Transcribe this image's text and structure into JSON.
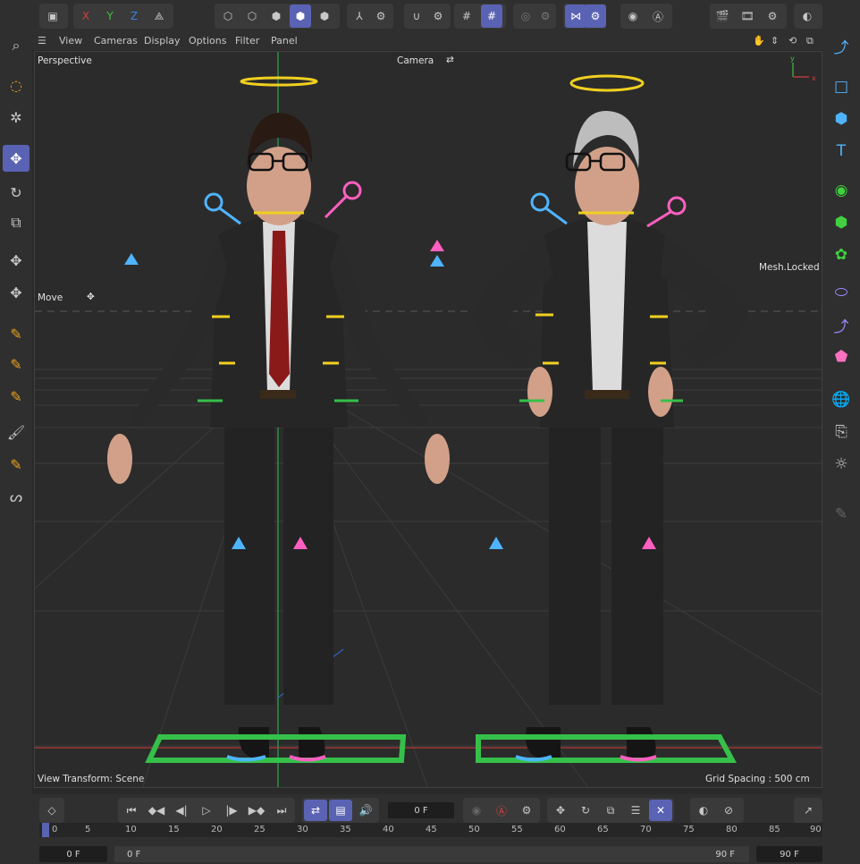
{
  "menu": [
    "View",
    "Cameras",
    "Display",
    "Options",
    "Filter",
    "Panel"
  ],
  "viewport": {
    "name": "Perspective",
    "camera": "Camera",
    "tool_label": "Move",
    "mesh_status": "Mesh.Locked",
    "view_transform": "View Transform: Scene",
    "grid_spacing": "Grid Spacing : 500 cm"
  },
  "axes": {
    "x": "X",
    "y": "Y",
    "z": "Z"
  },
  "timeline": {
    "current_frame": "0 F",
    "ruler": [
      "0",
      "5",
      "10",
      "15",
      "20",
      "25",
      "30",
      "35",
      "40",
      "45",
      "50",
      "55",
      "60",
      "65",
      "70",
      "75",
      "80",
      "85",
      "90"
    ],
    "start": "0 F",
    "range_start": "0 F",
    "range_end": "90 F",
    "end": "90 F"
  },
  "colors": {
    "accent": "#5a62b3",
    "x_axis": "#d04040",
    "y_axis": "#40b040",
    "handle_blue": "#4fb4ff",
    "handle_pink": "#ff5fc0",
    "foot_green": "#35c04a",
    "halo": "#f0d020"
  }
}
